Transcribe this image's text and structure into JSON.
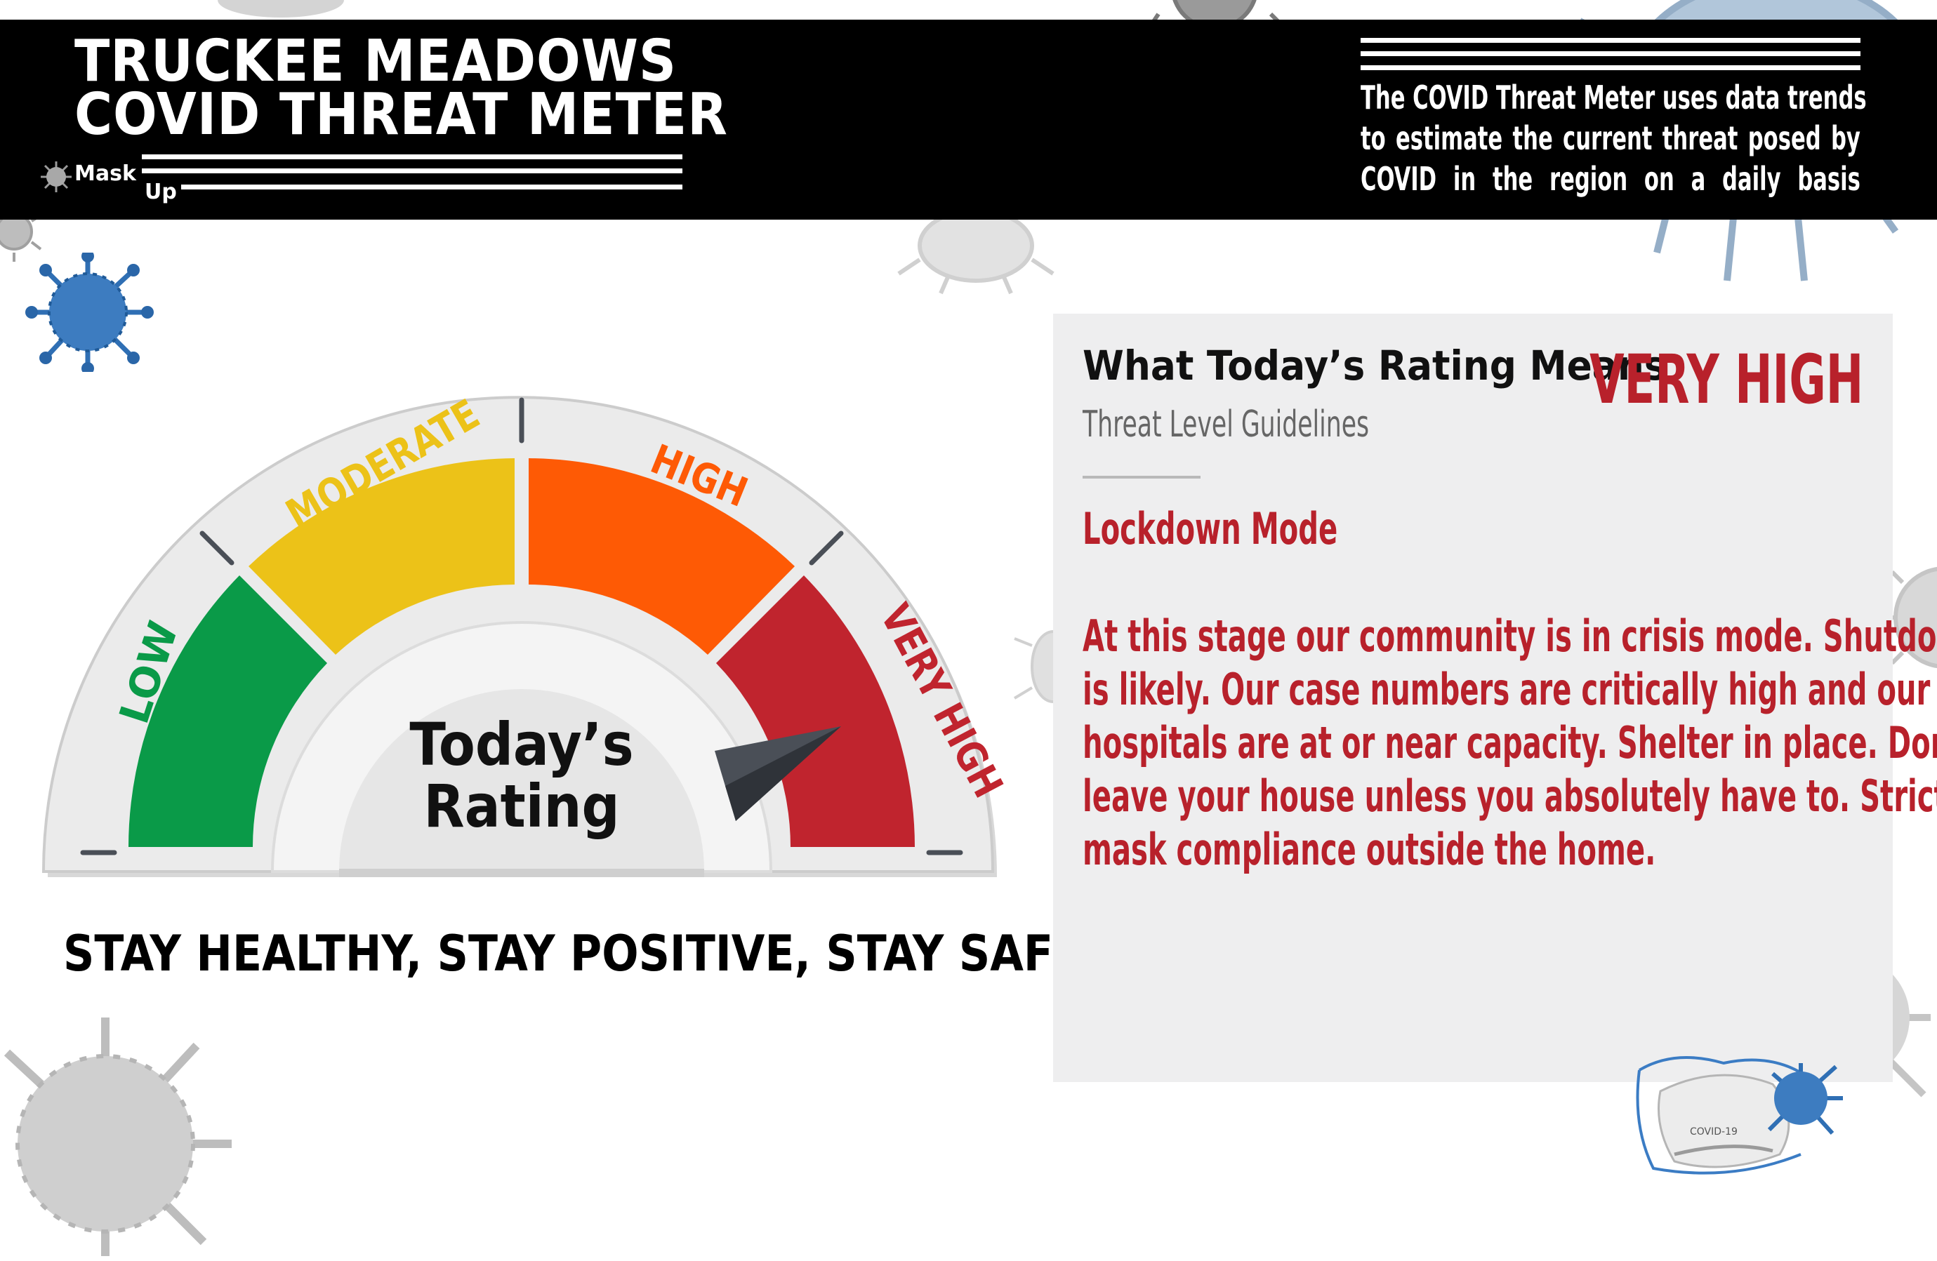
{
  "header": {
    "title_line1": "TRUCKEE MEADOWS",
    "title_line2": "COVID THREAT METER",
    "mask_word": "Mask",
    "up_word": "Up",
    "description_lines": [
      "The COVID Threat Meter uses data trends",
      "to estimate the current threat posed by",
      "COVID in the region on a daily basis"
    ]
  },
  "gauge": {
    "levels": [
      {
        "label": "LOW",
        "color": "#0a9a48"
      },
      {
        "label": "MODERATE",
        "color": "#ecc218"
      },
      {
        "label": "HIGH",
        "color": "#fe5a05"
      },
      {
        "label": "VERY HIGH",
        "color": "#c0242e"
      }
    ],
    "center_line1": "Today’s",
    "center_line2": "Rating",
    "current_level": "VERY HIGH"
  },
  "slogan": "STAY HEALTHY, STAY POSITIVE, STAY SAFE",
  "panel": {
    "title": "What Today’s Rating Means",
    "subtitle": "Threat Level Guidelines",
    "rating": "VERY HIGH",
    "mode": "Lockdown Mode",
    "body_lines": [
      "At this stage our community is in crisis mode. Shutdown",
      "is likely. Our case numbers are critically high and our",
      "hospitals are at or near capacity.  Shelter in place. Don’t",
      "leave your house unless you absolutely have to.  Strict",
      "mask compliance outside the home."
    ],
    "mask_label": "COVID-19"
  },
  "colors": {
    "accent_red": "#b8212b",
    "header_bg": "#000000",
    "panel_bg": "#eeeeef"
  }
}
